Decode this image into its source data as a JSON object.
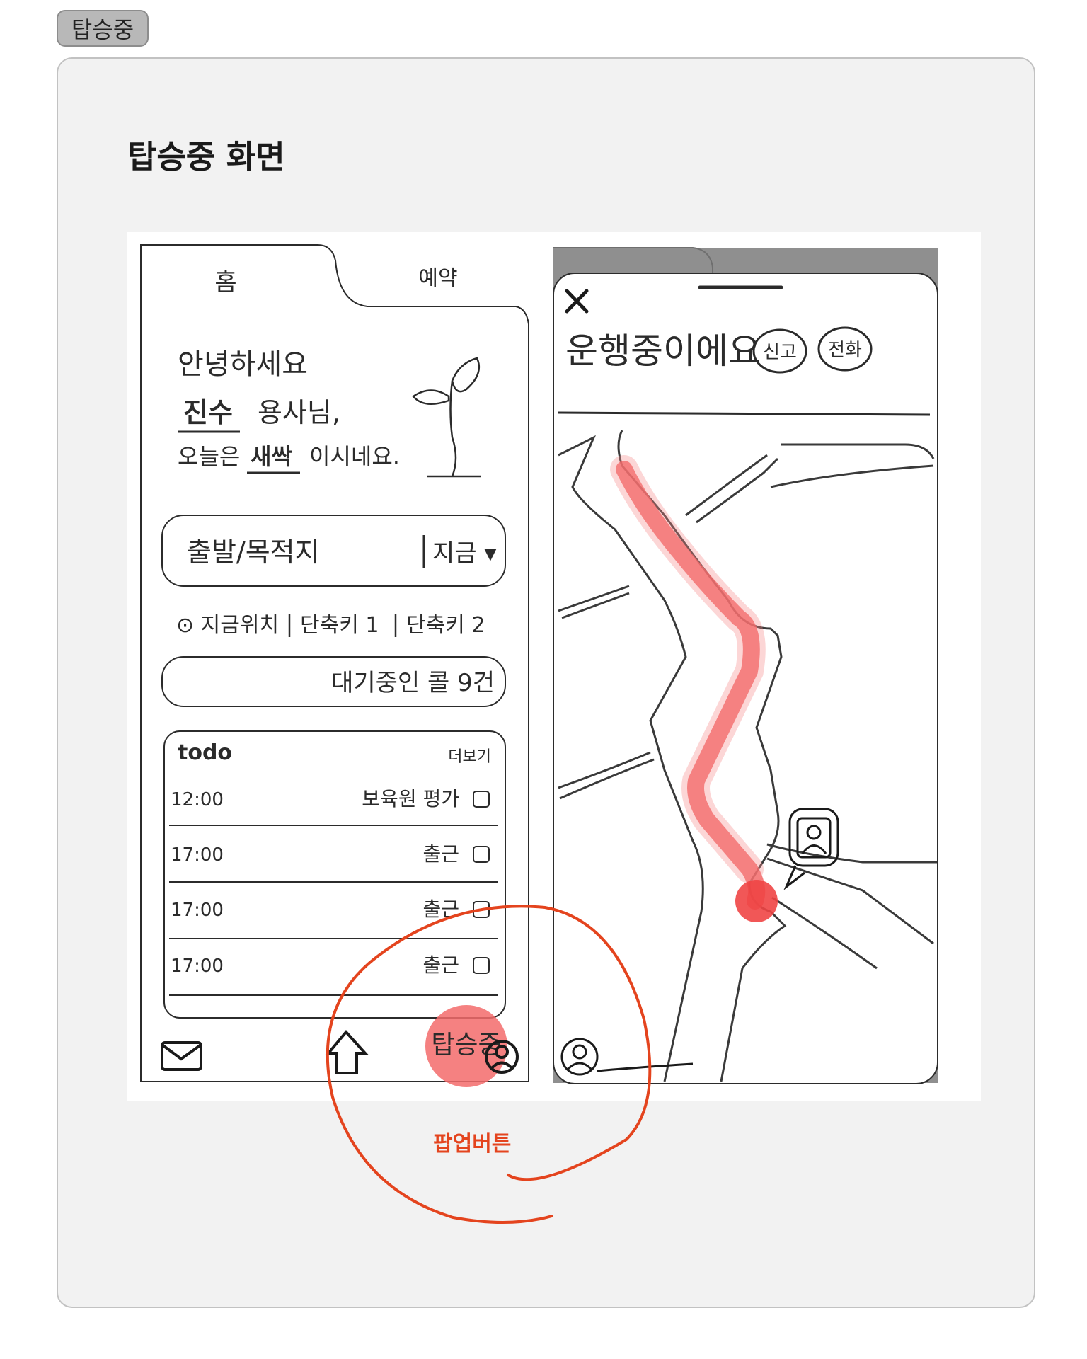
{
  "tag_label": "탑승중",
  "title": "탑승중 화면",
  "annotation": "팝업버튼",
  "accent_color": "#e4441e",
  "home_screen": {
    "tab_home": "홈",
    "tab_reservation": "예약",
    "greeting_line1": "안녕하세요",
    "greeting_name": "진수",
    "greeting_suffix": "용사님,",
    "greeting_today": "오늘은",
    "greeting_level": "새싹",
    "greeting_end": "이시네요.",
    "search_placeholder": "출발/목적지",
    "time_select": "지금 ▾",
    "shortcuts": [
      "⊙ 지금위치",
      "단축키 1",
      "단축키 2"
    ],
    "waiting_calls": "대기중인 콜 9건",
    "todo_title": "todo",
    "todo_more": "더보기",
    "todo_items": [
      {
        "time": "12:00",
        "task": "보육원 평가"
      },
      {
        "time": "17:00",
        "task": "출근"
      },
      {
        "time": "17:00",
        "task": "출근"
      },
      {
        "time": "17:00",
        "task": "출근"
      }
    ],
    "popup_button": "탑승중",
    "nav_icons": [
      "mail-icon",
      "home-icon",
      "profile-icon"
    ]
  },
  "ride_screen": {
    "status": "운행중이에요",
    "report_button": "신고",
    "call_button": "전화"
  }
}
